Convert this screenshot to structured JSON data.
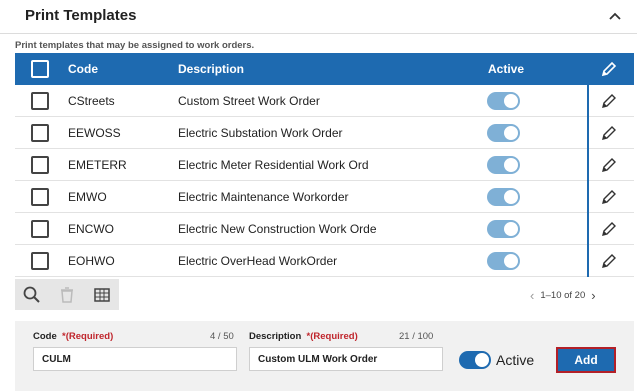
{
  "section": {
    "title": "Print Templates",
    "subtitle": "Print templates that may be assigned to work orders."
  },
  "table": {
    "columns": {
      "code": "Code",
      "description": "Description",
      "active": "Active"
    },
    "rows": [
      {
        "code": "CStreets",
        "description": "Custom Street Work Order",
        "active": true
      },
      {
        "code": "EEWOSS",
        "description": "Electric Substation Work Order",
        "active": true
      },
      {
        "code": "EMETERR",
        "description": "Electric Meter Residential Work Ord",
        "active": true
      },
      {
        "code": "EMWO",
        "description": "Electric Maintenance Workorder",
        "active": true
      },
      {
        "code": "ENCWO",
        "description": "Electric New Construction Work Orde",
        "active": true
      },
      {
        "code": "EOHWO",
        "description": "Electric OverHead WorkOrder",
        "active": true
      }
    ]
  },
  "pager": {
    "range": "1–10 of 20"
  },
  "form": {
    "code": {
      "label": "Code",
      "required": "*(Required)",
      "count": "4 / 50",
      "value": "CULM"
    },
    "description": {
      "label": "Description",
      "required": "*(Required)",
      "count": "21 / 100",
      "value": "Custom ULM Work Order"
    },
    "active_label": "Active",
    "add_label": "Add"
  },
  "colors": {
    "primary": "#1e6ab0",
    "toggle_on_light": "#7fb0d6",
    "required": "#c0262d",
    "add_border": "#b32028"
  },
  "icons": {
    "collapse": "chevron-up-icon",
    "edit": "pencil-icon",
    "search": "search-icon",
    "delete": "trash-icon",
    "columns": "table-columns-icon",
    "prev": "chevron-left-icon",
    "next": "chevron-right-icon"
  }
}
